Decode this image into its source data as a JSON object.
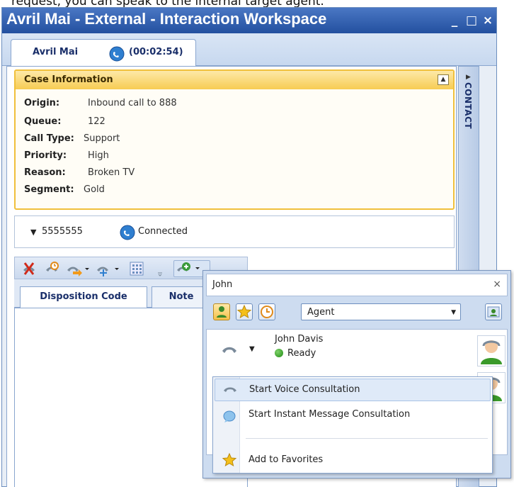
{
  "caption": "request, you can speak to the internal target agent.",
  "window": {
    "title": "Avril Mai - External - Interaction Workspace",
    "controls": [
      "_",
      "□",
      "×"
    ]
  },
  "interaction_tab": {
    "name": "Avril Mai",
    "timer": "(00:02:54)"
  },
  "case_info": {
    "header": "Case Information",
    "fields": [
      {
        "key": "Origin:",
        "value": "Inbound call to 888"
      },
      {
        "key": "Queue:",
        "value": "122"
      },
      {
        "key": "Call Type:",
        "value": "Support"
      },
      {
        "key": "Priority:",
        "value": "High"
      },
      {
        "key": "Reason:",
        "value": "Broken TV"
      },
      {
        "key": "Segment:",
        "value": "Gold"
      }
    ]
  },
  "party": {
    "number": "5555555",
    "status": "Connected"
  },
  "bottom_tabs": [
    "Disposition Code",
    "Note"
  ],
  "side_panel": {
    "label": "CONTACT"
  },
  "team_communicator": {
    "search_value": "John",
    "filter_select": "Agent",
    "result": {
      "name": "John Davis",
      "status": "Ready"
    }
  },
  "context_menu": {
    "items": [
      {
        "label": "Start Voice Consultation",
        "icon": "phone-handset-icon"
      },
      {
        "label": "Start Instant Message Consultation",
        "icon": "chat-bubble-icon"
      },
      {
        "label": "Add to Favorites",
        "icon": "star-icon"
      }
    ]
  },
  "colors": {
    "title_bar": "#2e5aa8",
    "case_border": "#f0c03c",
    "status_ready": "#2a9a1a"
  }
}
